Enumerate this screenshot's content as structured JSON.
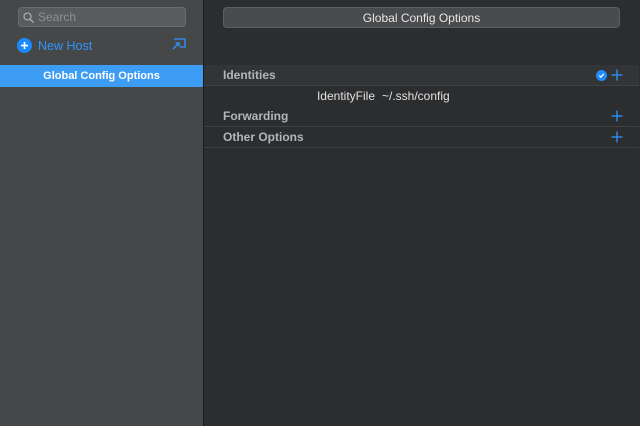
{
  "sidebar": {
    "search": {
      "placeholder": "Search",
      "value": ""
    },
    "new_host_label": "New Host",
    "hosts": [
      {
        "label": "Global Config Options",
        "selected": true
      }
    ]
  },
  "main": {
    "title": "Global Config Options",
    "sections": [
      {
        "title": "Identities",
        "options": [
          {
            "key": "IdentityFile",
            "value": "~/.ssh/config"
          }
        ]
      },
      {
        "title": "Forwarding",
        "options": []
      },
      {
        "title": "Other Options",
        "options": []
      }
    ]
  },
  "colors": {
    "accent": "#1a8bff",
    "selection": "#3d9cf4",
    "sidebar_bg": "#464749",
    "main_bg": "#2c2d2f"
  },
  "icons": {
    "search": "search-icon",
    "new_host": "plus-circle-icon",
    "import": "import-icon",
    "check": "check-circle-icon",
    "add": "plus-icon"
  }
}
